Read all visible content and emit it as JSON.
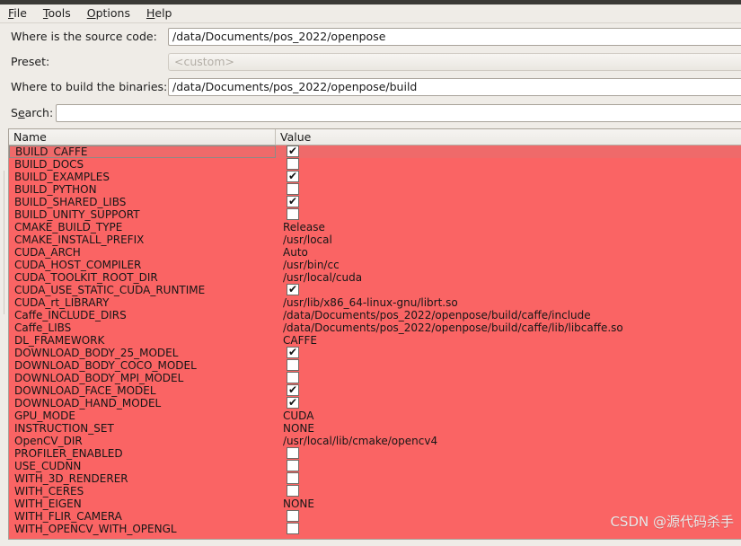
{
  "menu": {
    "items": [
      {
        "pre": "",
        "accel": "F",
        "post": "ile"
      },
      {
        "pre": "",
        "accel": "T",
        "post": "ools"
      },
      {
        "pre": "",
        "accel": "O",
        "post": "ptions"
      },
      {
        "pre": "",
        "accel": "H",
        "post": "elp"
      }
    ]
  },
  "form": {
    "source_label": "Where is the source code:",
    "source_value": "/data/Documents/pos_2022/openpose",
    "preset_label": "Preset:",
    "preset_value": "<custom>",
    "build_label": "Where to build the binaries:",
    "build_value": "/data/Documents/pos_2022/openpose/build",
    "search_label_pre": "S",
    "search_label_accel": "e",
    "search_label_post": "arch:",
    "search_value": "",
    "search_placeholder": ""
  },
  "table": {
    "columns": [
      "Name",
      "Value"
    ],
    "rows": [
      {
        "name": "BUILD_CAFFE",
        "type": "checkbox",
        "checked": true,
        "selected": true
      },
      {
        "name": "BUILD_DOCS",
        "type": "checkbox",
        "checked": false,
        "selected": false
      },
      {
        "name": "BUILD_EXAMPLES",
        "type": "checkbox",
        "checked": true,
        "selected": false
      },
      {
        "name": "BUILD_PYTHON",
        "type": "checkbox",
        "checked": false,
        "selected": false
      },
      {
        "name": "BUILD_SHARED_LIBS",
        "type": "checkbox",
        "checked": true,
        "selected": false
      },
      {
        "name": "BUILD_UNITY_SUPPORT",
        "type": "checkbox",
        "checked": false,
        "selected": false
      },
      {
        "name": "CMAKE_BUILD_TYPE",
        "type": "text",
        "value": "Release",
        "selected": false
      },
      {
        "name": "CMAKE_INSTALL_PREFIX",
        "type": "text",
        "value": "/usr/local",
        "selected": false
      },
      {
        "name": "CUDA_ARCH",
        "type": "text",
        "value": "Auto",
        "selected": false
      },
      {
        "name": "CUDA_HOST_COMPILER",
        "type": "text",
        "value": "/usr/bin/cc",
        "selected": false
      },
      {
        "name": "CUDA_TOOLKIT_ROOT_DIR",
        "type": "text",
        "value": "/usr/local/cuda",
        "selected": false
      },
      {
        "name": "CUDA_USE_STATIC_CUDA_RUNTIME",
        "type": "checkbox",
        "checked": true,
        "selected": false
      },
      {
        "name": "CUDA_rt_LIBRARY",
        "type": "text",
        "value": "/usr/lib/x86_64-linux-gnu/librt.so",
        "selected": false
      },
      {
        "name": "Caffe_INCLUDE_DIRS",
        "type": "text",
        "value": "/data/Documents/pos_2022/openpose/build/caffe/include",
        "selected": false
      },
      {
        "name": "Caffe_LIBS",
        "type": "text",
        "value": "/data/Documents/pos_2022/openpose/build/caffe/lib/libcaffe.so",
        "selected": false
      },
      {
        "name": "DL_FRAMEWORK",
        "type": "text",
        "value": "CAFFE",
        "selected": false
      },
      {
        "name": "DOWNLOAD_BODY_25_MODEL",
        "type": "checkbox",
        "checked": true,
        "selected": false
      },
      {
        "name": "DOWNLOAD_BODY_COCO_MODEL",
        "type": "checkbox",
        "checked": false,
        "selected": false
      },
      {
        "name": "DOWNLOAD_BODY_MPI_MODEL",
        "type": "checkbox",
        "checked": false,
        "selected": false
      },
      {
        "name": "DOWNLOAD_FACE_MODEL",
        "type": "checkbox",
        "checked": true,
        "selected": false
      },
      {
        "name": "DOWNLOAD_HAND_MODEL",
        "type": "checkbox",
        "checked": true,
        "selected": false
      },
      {
        "name": "GPU_MODE",
        "type": "text",
        "value": "CUDA",
        "selected": false
      },
      {
        "name": "INSTRUCTION_SET",
        "type": "text",
        "value": "NONE",
        "selected": false
      },
      {
        "name": "OpenCV_DIR",
        "type": "text",
        "value": "/usr/local/lib/cmake/opencv4",
        "selected": false
      },
      {
        "name": "PROFILER_ENABLED",
        "type": "checkbox",
        "checked": false,
        "selected": false
      },
      {
        "name": "USE_CUDNN",
        "type": "checkbox",
        "checked": false,
        "selected": false
      },
      {
        "name": "WITH_3D_RENDERER",
        "type": "checkbox",
        "checked": false,
        "selected": false
      },
      {
        "name": "WITH_CERES",
        "type": "checkbox",
        "checked": false,
        "selected": false
      },
      {
        "name": "WITH_EIGEN",
        "type": "text",
        "value": "NONE",
        "selected": false
      },
      {
        "name": "WITH_FLIR_CAMERA",
        "type": "checkbox",
        "checked": false,
        "selected": false
      },
      {
        "name": "WITH_OPENCV_WITH_OPENGL",
        "type": "checkbox",
        "checked": false,
        "selected": false
      }
    ]
  },
  "watermark": {
    "text": "CSDN @源代码杀手"
  },
  "colors": {
    "row_background": "#fa6464",
    "selected_row": "#ef6a6a",
    "window_background": "#efece7",
    "titlebar": "#3b3a36"
  }
}
